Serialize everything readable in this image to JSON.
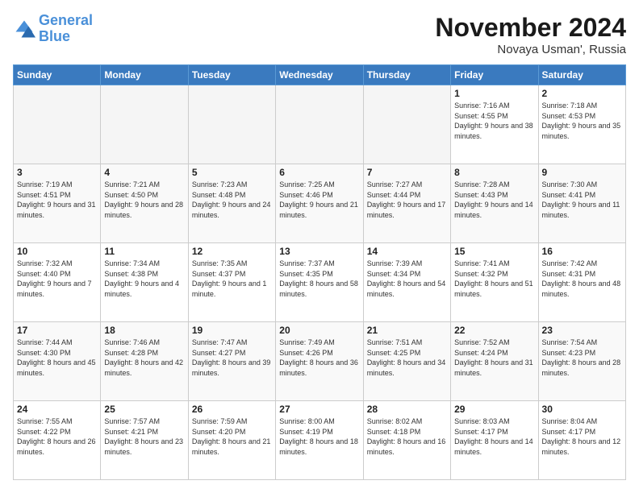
{
  "header": {
    "logo_line1": "General",
    "logo_line2": "Blue",
    "month_title": "November 2024",
    "location": "Novaya Usman', Russia"
  },
  "days_of_week": [
    "Sunday",
    "Monday",
    "Tuesday",
    "Wednesday",
    "Thursday",
    "Friday",
    "Saturday"
  ],
  "weeks": [
    [
      {
        "day": "",
        "empty": true
      },
      {
        "day": "",
        "empty": true
      },
      {
        "day": "",
        "empty": true
      },
      {
        "day": "",
        "empty": true
      },
      {
        "day": "",
        "empty": true
      },
      {
        "day": "1",
        "sunrise": "7:16 AM",
        "sunset": "4:55 PM",
        "daylight": "9 hours and 38 minutes."
      },
      {
        "day": "2",
        "sunrise": "7:18 AM",
        "sunset": "4:53 PM",
        "daylight": "9 hours and 35 minutes."
      }
    ],
    [
      {
        "day": "3",
        "sunrise": "7:19 AM",
        "sunset": "4:51 PM",
        "daylight": "9 hours and 31 minutes."
      },
      {
        "day": "4",
        "sunrise": "7:21 AM",
        "sunset": "4:50 PM",
        "daylight": "9 hours and 28 minutes."
      },
      {
        "day": "5",
        "sunrise": "7:23 AM",
        "sunset": "4:48 PM",
        "daylight": "9 hours and 24 minutes."
      },
      {
        "day": "6",
        "sunrise": "7:25 AM",
        "sunset": "4:46 PM",
        "daylight": "9 hours and 21 minutes."
      },
      {
        "day": "7",
        "sunrise": "7:27 AM",
        "sunset": "4:44 PM",
        "daylight": "9 hours and 17 minutes."
      },
      {
        "day": "8",
        "sunrise": "7:28 AM",
        "sunset": "4:43 PM",
        "daylight": "9 hours and 14 minutes."
      },
      {
        "day": "9",
        "sunrise": "7:30 AM",
        "sunset": "4:41 PM",
        "daylight": "9 hours and 11 minutes."
      }
    ],
    [
      {
        "day": "10",
        "sunrise": "7:32 AM",
        "sunset": "4:40 PM",
        "daylight": "9 hours and 7 minutes."
      },
      {
        "day": "11",
        "sunrise": "7:34 AM",
        "sunset": "4:38 PM",
        "daylight": "9 hours and 4 minutes."
      },
      {
        "day": "12",
        "sunrise": "7:35 AM",
        "sunset": "4:37 PM",
        "daylight": "9 hours and 1 minute."
      },
      {
        "day": "13",
        "sunrise": "7:37 AM",
        "sunset": "4:35 PM",
        "daylight": "8 hours and 58 minutes."
      },
      {
        "day": "14",
        "sunrise": "7:39 AM",
        "sunset": "4:34 PM",
        "daylight": "8 hours and 54 minutes."
      },
      {
        "day": "15",
        "sunrise": "7:41 AM",
        "sunset": "4:32 PM",
        "daylight": "8 hours and 51 minutes."
      },
      {
        "day": "16",
        "sunrise": "7:42 AM",
        "sunset": "4:31 PM",
        "daylight": "8 hours and 48 minutes."
      }
    ],
    [
      {
        "day": "17",
        "sunrise": "7:44 AM",
        "sunset": "4:30 PM",
        "daylight": "8 hours and 45 minutes."
      },
      {
        "day": "18",
        "sunrise": "7:46 AM",
        "sunset": "4:28 PM",
        "daylight": "8 hours and 42 minutes."
      },
      {
        "day": "19",
        "sunrise": "7:47 AM",
        "sunset": "4:27 PM",
        "daylight": "8 hours and 39 minutes."
      },
      {
        "day": "20",
        "sunrise": "7:49 AM",
        "sunset": "4:26 PM",
        "daylight": "8 hours and 36 minutes."
      },
      {
        "day": "21",
        "sunrise": "7:51 AM",
        "sunset": "4:25 PM",
        "daylight": "8 hours and 34 minutes."
      },
      {
        "day": "22",
        "sunrise": "7:52 AM",
        "sunset": "4:24 PM",
        "daylight": "8 hours and 31 minutes."
      },
      {
        "day": "23",
        "sunrise": "7:54 AM",
        "sunset": "4:23 PM",
        "daylight": "8 hours and 28 minutes."
      }
    ],
    [
      {
        "day": "24",
        "sunrise": "7:55 AM",
        "sunset": "4:22 PM",
        "daylight": "8 hours and 26 minutes."
      },
      {
        "day": "25",
        "sunrise": "7:57 AM",
        "sunset": "4:21 PM",
        "daylight": "8 hours and 23 minutes."
      },
      {
        "day": "26",
        "sunrise": "7:59 AM",
        "sunset": "4:20 PM",
        "daylight": "8 hours and 21 minutes."
      },
      {
        "day": "27",
        "sunrise": "8:00 AM",
        "sunset": "4:19 PM",
        "daylight": "8 hours and 18 minutes."
      },
      {
        "day": "28",
        "sunrise": "8:02 AM",
        "sunset": "4:18 PM",
        "daylight": "8 hours and 16 minutes."
      },
      {
        "day": "29",
        "sunrise": "8:03 AM",
        "sunset": "4:17 PM",
        "daylight": "8 hours and 14 minutes."
      },
      {
        "day": "30",
        "sunrise": "8:04 AM",
        "sunset": "4:17 PM",
        "daylight": "8 hours and 12 minutes."
      }
    ]
  ]
}
